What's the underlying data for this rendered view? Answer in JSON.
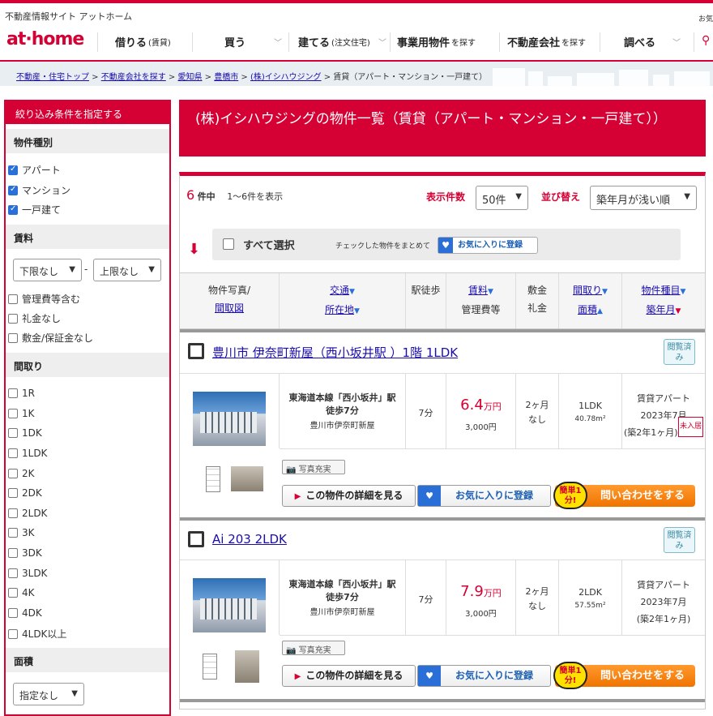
{
  "header": {
    "site_label": "不動産情報サイト アットホーム",
    "os_label": "お気",
    "logo": "at·home",
    "nav": [
      {
        "label": "借りる",
        "sub": "(賃貸)"
      },
      {
        "label": "買う",
        "sub": ""
      },
      {
        "label": "建てる",
        "sub": "(注文住宅)"
      },
      {
        "label": "事業用物件",
        "sub": "を探す"
      },
      {
        "label": "不動産会社",
        "sub": "を探す"
      },
      {
        "label": "調べる",
        "sub": ""
      }
    ]
  },
  "breadcrumb": [
    "不動産・住宅トップ",
    "不動産会社を探す",
    "愛知県",
    "豊橋市",
    "(株)イシハウジング"
  ],
  "breadcrumb_current": "賃貸（アパート・マンション・一戸建て）",
  "sidebar": {
    "heading": "絞り込み条件を指定する",
    "type_heading": "物件種別",
    "types": [
      {
        "label": "アパート",
        "checked": true
      },
      {
        "label": "マンション",
        "checked": true
      },
      {
        "label": "一戸建て",
        "checked": true
      }
    ],
    "rent_heading": "賃料",
    "rent_min": "下限なし",
    "rent_max": "上限なし",
    "rent_dash": "-",
    "rent_opts": [
      "管理費等含む",
      "礼金なし",
      "敷金/保証金なし"
    ],
    "layout_heading": "間取り",
    "layouts": [
      "1R",
      "1K",
      "1DK",
      "1LDK",
      "2K",
      "2DK",
      "2LDK",
      "3K",
      "3DK",
      "3LDK",
      "4K",
      "4DK",
      "4LDK以上"
    ],
    "area_heading": "面積",
    "area_select": "指定なし"
  },
  "main": {
    "title": "(株)イシハウジングの物件一覧（賃貸（アパート・マンション・一戸建て））",
    "count": "6",
    "count_unit": "件中",
    "range": "1～6件を表示",
    "per_page_label": "表示件数",
    "per_page": "50件",
    "sort_label": "並び替え",
    "sort": "築年月が浅い順",
    "select_all": "すべて選択",
    "bulk_text": "チェックした物件をまとめて",
    "bulk_fav": "お気に入りに登録",
    "columns": {
      "photo": "物件写真/",
      "floorplan": "間取図",
      "traffic": "交通",
      "location": "所在地",
      "walk": "駅徒歩",
      "rent": "賃料",
      "mgmt": "管理費等",
      "deposit": "敷金",
      "key": "礼金",
      "layout": "間取り",
      "area": "面積",
      "type": "物件種目",
      "built": "築年月"
    }
  },
  "listings": [
    {
      "title": "豊川市 伊奈町新屋（西小坂井駅 ）1階 1LDK",
      "viewed": "閲覧済み",
      "station": "東海道本線「西小坂井」駅 徒歩7分",
      "address": "豊川市伊奈町新屋",
      "walk": "7分",
      "rent": "6.4",
      "rent_unit": "万円",
      "mgmt": "3,000円",
      "deposit": "2ヶ月",
      "key_money": "なし",
      "layout": "1LDK",
      "area": "40.78m²",
      "type": "賃貸アパート",
      "built": "2023年7月",
      "age": "(築2年1ヶ月)",
      "badge": "未入居",
      "photo_tag": "写真充実",
      "detail_btn": "この物件の詳細を見る",
      "fav_btn": "お気に入りに登録",
      "easy": "簡単1分!",
      "inquiry_btn": "問い合わせをする"
    },
    {
      "title": "Ai 203 2LDK",
      "viewed": "閲覧済み",
      "station": "東海道本線「西小坂井」駅 徒歩7分",
      "address": "豊川市伊奈町新屋",
      "walk": "7分",
      "rent": "7.9",
      "rent_unit": "万円",
      "mgmt": "3,000円",
      "deposit": "2ヶ月",
      "key_money": "なし",
      "layout": "2LDK",
      "area": "57.55m²",
      "type": "賃貸アパート",
      "built": "2023年7月",
      "age": "(築2年1ヶ月)",
      "badge": "",
      "photo_tag": "写真充実",
      "detail_btn": "この物件の詳細を見る",
      "fav_btn": "お気に入りに登録",
      "easy": "簡単1分!",
      "inquiry_btn": "問い合わせをする"
    }
  ]
}
